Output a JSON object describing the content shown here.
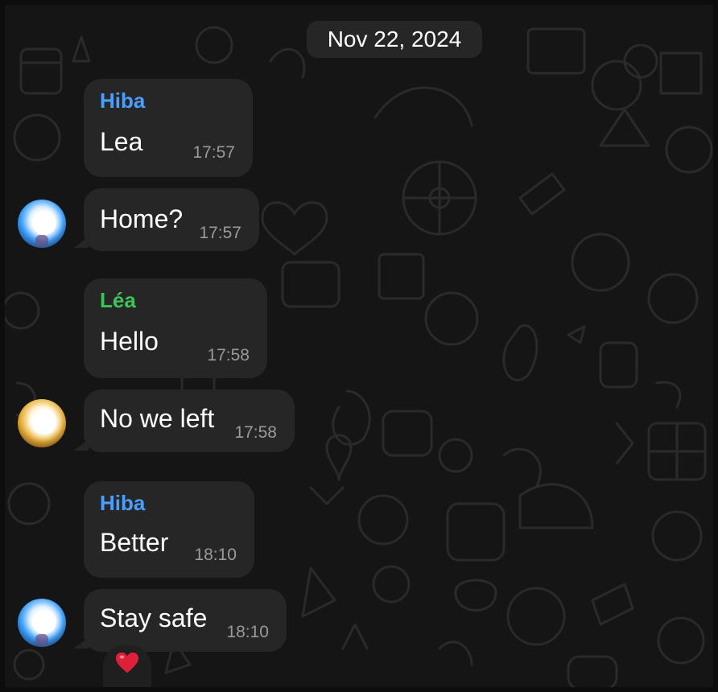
{
  "date_header": "Nov 22, 2024",
  "messages": [
    {
      "sender": "Hiba",
      "sender_color": "#4a9eff",
      "text": "Lea",
      "time": "17:57"
    },
    {
      "text": "Home?",
      "time": "17:57"
    },
    {
      "sender": "Léa",
      "sender_color": "#3fc25a",
      "text": "Hello",
      "time": "17:58"
    },
    {
      "text": "No we left",
      "time": "17:58"
    },
    {
      "sender": "Hiba",
      "sender_color": "#4a9eff",
      "text": "Better",
      "time": "18:10"
    },
    {
      "text": "Stay safe",
      "time": "18:10"
    }
  ],
  "reaction": {
    "icon": "red-heart-icon",
    "color": "#e0203a"
  },
  "colors": {
    "background": "#151515",
    "bubble": "#262626",
    "timestamp": "#9a9a9a",
    "avatar_glow_blue": "#3aa0ff",
    "avatar_glow_gold": "#e8b23a"
  }
}
